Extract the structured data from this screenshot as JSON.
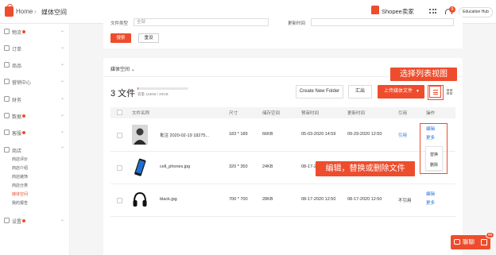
{
  "header": {
    "home_label": "Home",
    "breadcrumb_separator": "›",
    "breadcrumb_current": "媒体空间",
    "brand": "Shopee卖家",
    "notification_count": "9",
    "account": "Education Hub"
  },
  "sidebar": {
    "items": [
      {
        "label": "物流",
        "icon": "truck-icon",
        "dot": true
      },
      {
        "label": "订单",
        "icon": "order-icon",
        "dot": false
      },
      {
        "label": "商品",
        "icon": "product-icon",
        "dot": false
      },
      {
        "label": "营销中心",
        "icon": "marketing-icon",
        "dot": false
      },
      {
        "label": "财务",
        "icon": "wallet-icon",
        "dot": false
      },
      {
        "label": "数据",
        "icon": "chart-icon",
        "dot": true
      },
      {
        "label": "客服",
        "icon": "chat-icon",
        "dot": true
      },
      {
        "label": "商店",
        "icon": "shop-icon",
        "dot": false
      },
      {
        "label": "设置",
        "icon": "gear-icon",
        "dot": true
      }
    ],
    "shop_subitems": [
      "商店评价",
      "商店介绍",
      "商店装饰",
      "商店分类",
      "媒体空间",
      "我的报告"
    ],
    "active_subitem": "媒体空间"
  },
  "filter": {
    "file_type_label": "文件类型",
    "file_type_value": "全部",
    "updated_time_label": "更新时间",
    "search_label": "搜索",
    "reset_label": "重设"
  },
  "media": {
    "type_selector": "媒体空间",
    "file_count": "3 文件",
    "storage_text": "容量 118KB / 20GB",
    "storage_used_fraction": 0.01,
    "new_folder_label": "Create New Folder",
    "export_label": "汇出",
    "upload_label": "上传媒体文件",
    "columns": [
      "文件名称",
      "尺寸",
      "储存空间",
      "预审时间",
      "更新时间",
      "引用",
      "操作"
    ],
    "rows": [
      {
        "name": "批注 2020-02-19 18275...",
        "size": "183 * 189",
        "storage": "66KB",
        "created": "05-03-2020 14:59",
        "updated": "09-29-2020 12:50",
        "reference": "引用",
        "reference_is_link": true,
        "actions": [
          "编辑",
          "更多"
        ],
        "thumb": "person"
      },
      {
        "name": "cell_phones.jpg",
        "size": "320 * 350",
        "storage": "24KB",
        "created": "08-17-2020",
        "updated": "",
        "reference": "",
        "reference_is_link": false,
        "actions": [],
        "thumb": "phone"
      },
      {
        "name": "black.jpg",
        "size": "700 * 700",
        "storage": "28KB",
        "created": "08-17-2020 12:50",
        "updated": "08-17-2020 12:50",
        "reference": "不引用",
        "reference_is_link": false,
        "actions": [
          "编辑",
          "更多"
        ],
        "thumb": "headphones"
      }
    ],
    "popover_items": [
      "替换",
      "删除"
    ]
  },
  "annotations": {
    "list_view_callout": "选择列表视图",
    "edit_callout": "编辑，替换或删除文件"
  },
  "chat": {
    "label": "聊聊",
    "badge": "99"
  },
  "colors": {
    "accent": "#ee4d2d",
    "link": "#2673dd"
  }
}
